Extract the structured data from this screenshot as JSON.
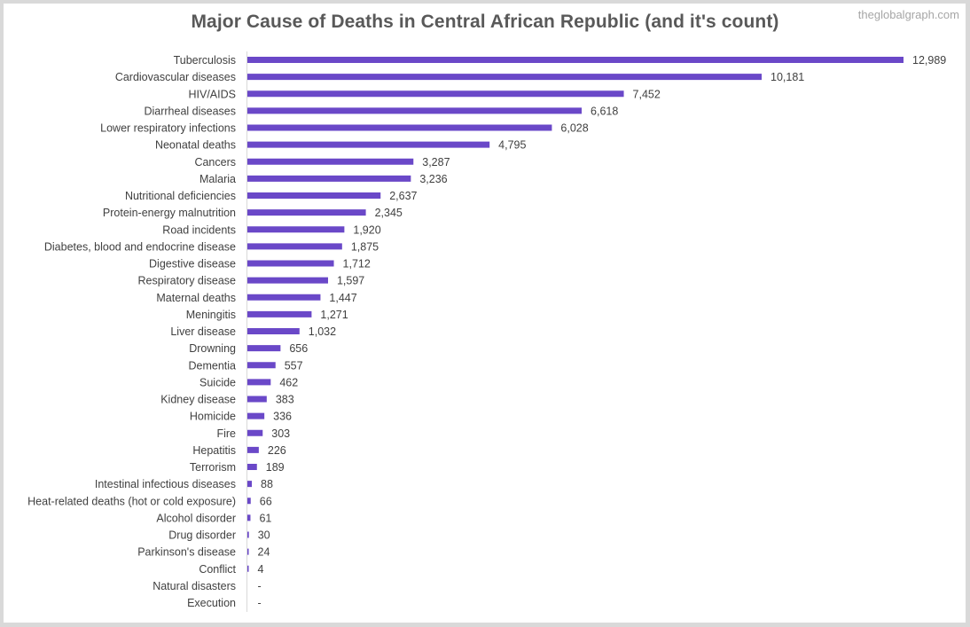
{
  "watermark": "theglobalgraph.com",
  "chart_data": {
    "type": "bar",
    "orientation": "horizontal",
    "title": "Major Cause of Deaths in Central African Republic (and it's count)",
    "xlabel": "",
    "ylabel": "",
    "xlim": [
      0,
      13000
    ],
    "grid": false,
    "legend": "none",
    "bar_color": "#6a48c8",
    "categories": [
      "Tuberculosis",
      "Cardiovascular diseases",
      "HIV/AIDS",
      "Diarrheal diseases",
      "Lower respiratory infections",
      "Neonatal deaths",
      "Cancers",
      "Malaria",
      "Nutritional deficiencies",
      "Protein-energy malnutrition",
      "Road incidents",
      "Diabetes, blood and endocrine disease",
      "Digestive disease",
      "Respiratory disease",
      "Maternal deaths",
      "Meningitis",
      "Liver disease",
      "Drowning",
      "Dementia",
      "Suicide",
      "Kidney disease",
      "Homicide",
      "Fire",
      "Hepatitis",
      "Terrorism",
      "Intestinal infectious diseases",
      "Heat-related deaths (hot or cold exposure)",
      "Alcohol disorder",
      "Drug disorder",
      "Parkinson's disease",
      "Conflict",
      "Natural disasters",
      "Execution"
    ],
    "values": [
      12989,
      10181,
      7452,
      6618,
      6028,
      4795,
      3287,
      3236,
      2637,
      2345,
      1920,
      1875,
      1712,
      1597,
      1447,
      1271,
      1032,
      656,
      557,
      462,
      383,
      336,
      303,
      226,
      189,
      88,
      66,
      61,
      30,
      24,
      4,
      0,
      0
    ],
    "data_labels": [
      "12,989",
      "10,181",
      "7,452",
      "6,618",
      "6,028",
      "4,795",
      "3,287",
      "3,236",
      "2,637",
      "2,345",
      "1,920",
      "1,875",
      "1,712",
      "1,597",
      "1,447",
      "1,271",
      "1,032",
      "656",
      "557",
      "462",
      "383",
      "336",
      "303",
      "226",
      "189",
      "88",
      "66",
      "61",
      "30",
      "24",
      "4",
      "-",
      "-"
    ]
  }
}
